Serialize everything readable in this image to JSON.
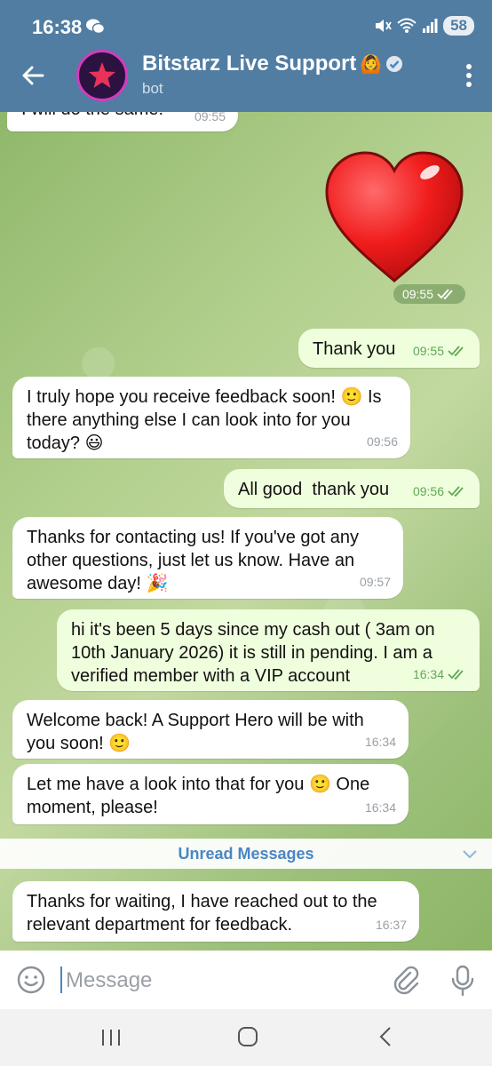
{
  "status_bar": {
    "time": "16:38",
    "battery": "58"
  },
  "header": {
    "title": "Bitstarz Live Support",
    "title_emoji": "🙆",
    "subtitle": "bot"
  },
  "colors": {
    "header": "#517da2",
    "incoming_bubble": "#ffffff",
    "outgoing_bubble": "#effedd",
    "tick": "#5fa856",
    "accent": "#4a86c4"
  },
  "messages": [
    {
      "dir": "in",
      "text": "I will do the same!",
      "time": "09:55"
    },
    {
      "dir": "out",
      "type": "sticker",
      "sticker": "red-heart",
      "time": "09:55"
    },
    {
      "dir": "out",
      "text": "Thank you",
      "time": "09:55"
    },
    {
      "dir": "in",
      "text": "I truly hope you receive feedback soon! 🙂 Is there anything else I can look into for you today? 😃",
      "time": "09:56"
    },
    {
      "dir": "out",
      "text": "All good  thank you",
      "time": "09:56"
    },
    {
      "dir": "in",
      "text": "Thanks for contacting us! If you've got any other questions, just let us know. Have an awesome day! 🎉",
      "time": "09:57"
    },
    {
      "dir": "out",
      "text": "hi it's been 5 days since my cash out ( 3am on 10th January 2026) it is still in pending. I am a verified member with a VIP account",
      "time": "16:34"
    },
    {
      "dir": "in",
      "text": "Welcome back! A Support Hero will be with you soon! 🙂",
      "time": "16:34"
    },
    {
      "dir": "in",
      "text": "Let me have a look into that for you 🙂 One moment, please!",
      "time": "16:34"
    },
    {
      "dir": "in",
      "text": "Thanks for waiting, I have reached out to the relevant department for feedback.",
      "time": "16:37"
    }
  ],
  "unread_label": "Unread Messages",
  "composer": {
    "placeholder": "Message"
  },
  "icons": [
    "back-arrow-icon",
    "verified-icon",
    "more-vert-icon",
    "emoji-icon",
    "attach-icon",
    "mic-icon"
  ]
}
